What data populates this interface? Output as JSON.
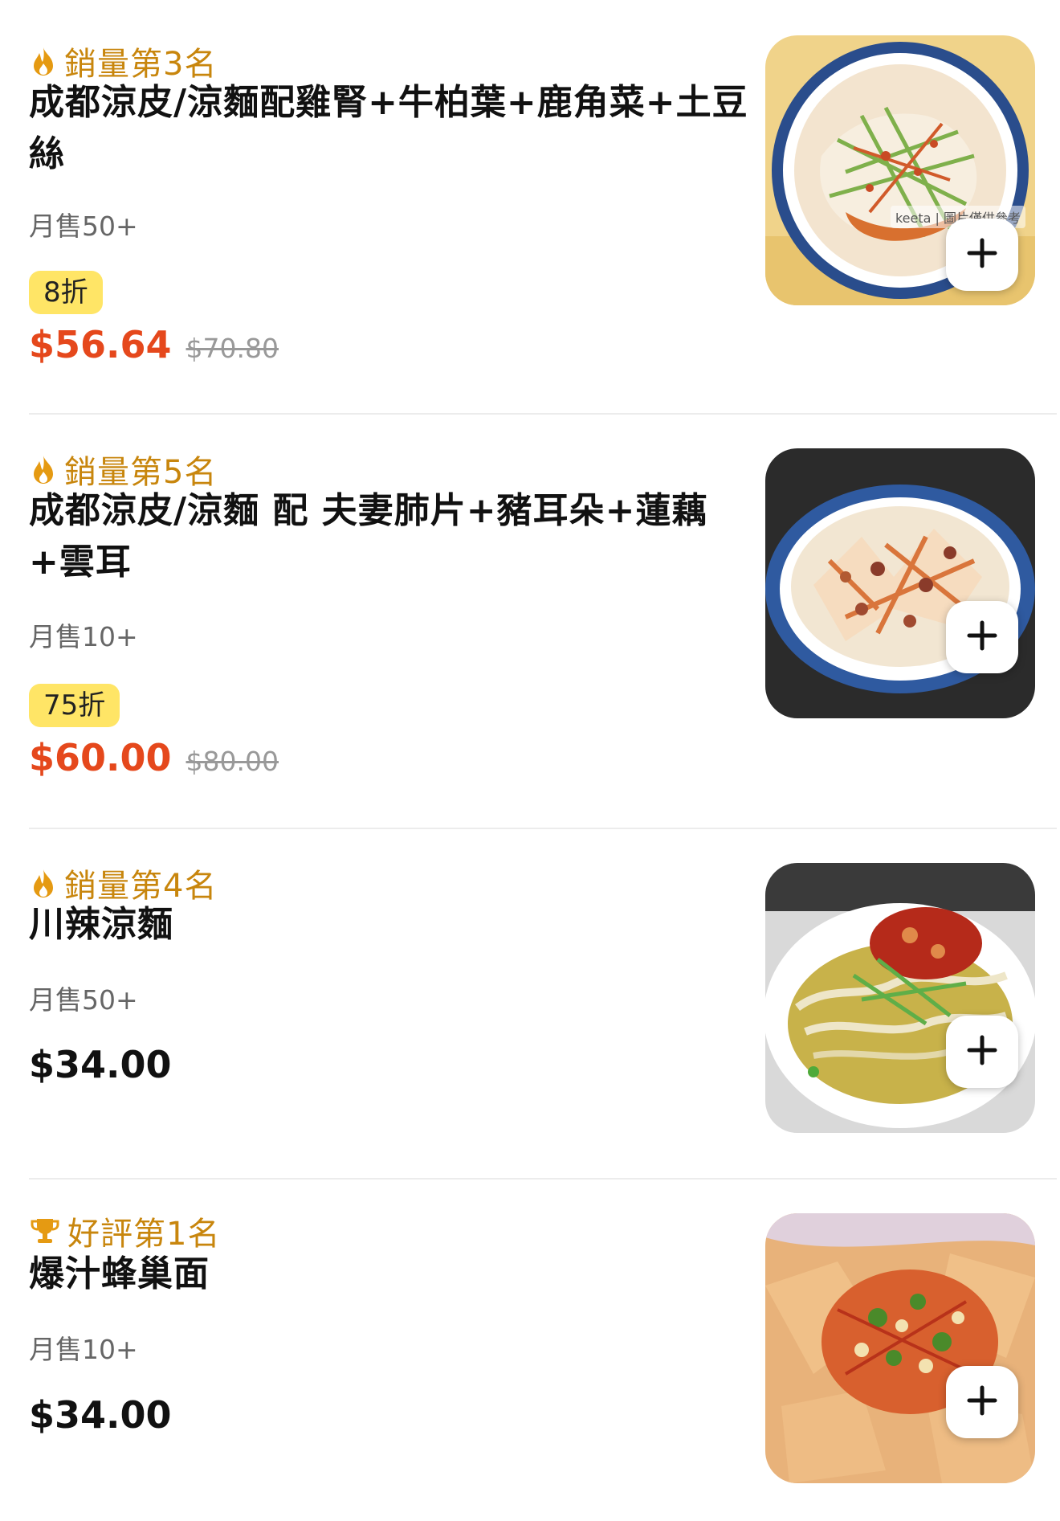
{
  "colors": {
    "rank_accent": "#c8860d",
    "sale_price": "#e5481c",
    "discount_badge_bg": "#ffe566",
    "muted_text": "#666666"
  },
  "items": [
    {
      "rank_icon": "flame-icon",
      "rank_label": "銷量第3名",
      "name": "成都涼皮/涼麵配雞腎+牛柏葉+鹿角菜+土豆絲",
      "monthly_sales": "月售50+",
      "discount": "8折",
      "price": "$56.64",
      "original_price": "$70.80",
      "image_caption": "keeta | 圖片僅供參考",
      "add_icon": "plus-icon"
    },
    {
      "rank_icon": "flame-icon",
      "rank_label": "銷量第5名",
      "name": "成都涼皮/涼麵 配 夫妻肺片+豬耳朵+蓮藕+雲耳",
      "monthly_sales": "月售10+",
      "discount": "75折",
      "price": "$60.00",
      "original_price": "$80.00",
      "add_icon": "plus-icon"
    },
    {
      "rank_icon": "flame-icon",
      "rank_label": "銷量第4名",
      "name": "川辣涼麵",
      "monthly_sales": "月售50+",
      "price": "$34.00",
      "add_icon": "plus-icon"
    },
    {
      "rank_icon": "trophy-icon",
      "rank_label": "好評第1名",
      "name": "爆汁蜂巢面",
      "monthly_sales": "月售10+",
      "price": "$34.00",
      "add_icon": "plus-icon"
    }
  ]
}
